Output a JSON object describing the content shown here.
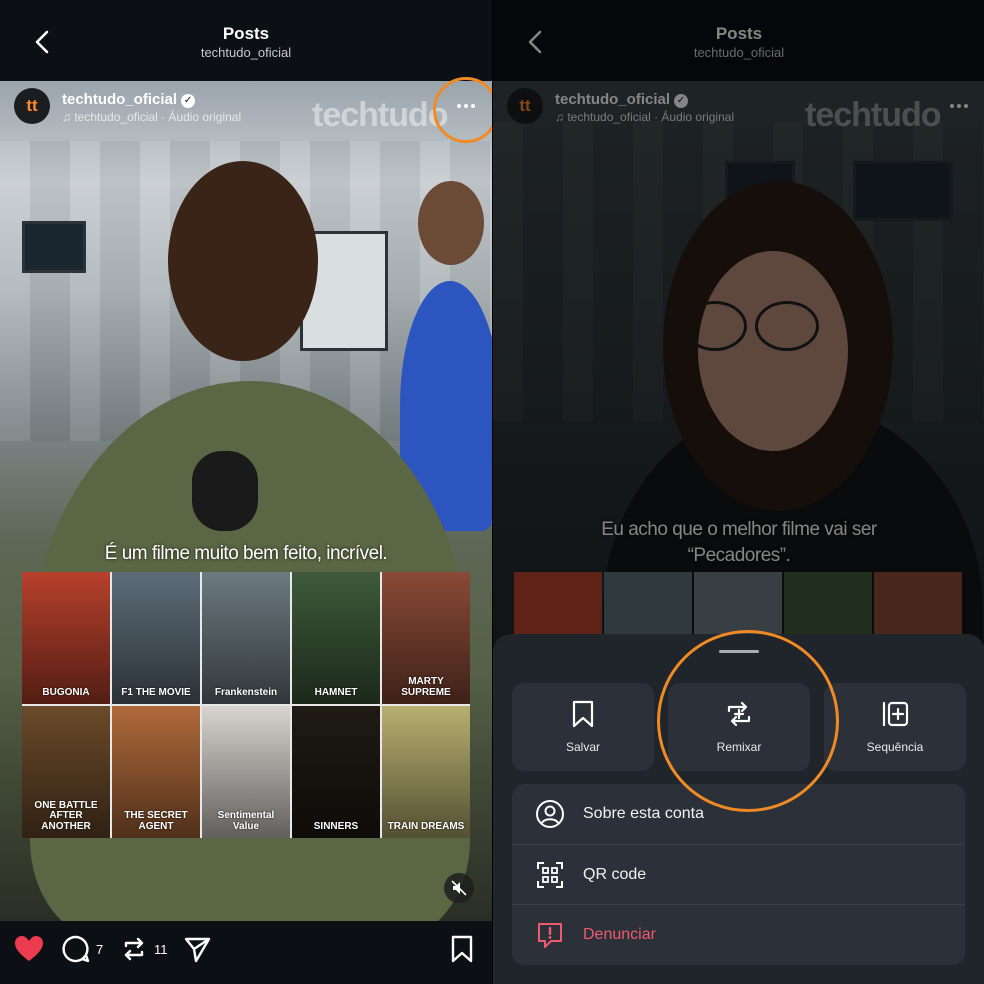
{
  "left": {
    "header": {
      "title": "Posts",
      "subtitle": "techtudo_oficial"
    },
    "account": {
      "avatar": "tt",
      "name": "techtudo_oficial",
      "audio": "techtudo_oficial · Áudio original",
      "watermark": "techtudo"
    },
    "caption": "É um filme muito bem feito, incrível.",
    "posters": [
      {
        "title": "BUGONIA",
        "color": "#b7412c"
      },
      {
        "title": "F1 THE MOVIE",
        "color": "#5d6d78"
      },
      {
        "title": "Frankenstein",
        "color": "#6c7a80"
      },
      {
        "title": "HAMNET",
        "color": "#3e5a3a"
      },
      {
        "title": "MARTY SUPREME",
        "color": "#8a4a36"
      },
      {
        "title": "ONE BATTLE AFTER ANOTHER",
        "color": "#6a4a2a"
      },
      {
        "title": "THE SECRET AGENT",
        "color": "#b06a3a"
      },
      {
        "title": "Sentimental Value",
        "color": "#d8d4cf"
      },
      {
        "title": "SINNERS",
        "color": "#1f1a14"
      },
      {
        "title": "TRAIN DREAMS",
        "color": "#b8b070"
      }
    ],
    "actions": {
      "comments": "7",
      "reposts": "11"
    }
  },
  "right": {
    "header": {
      "title": "Posts",
      "subtitle": "techtudo_oficial"
    },
    "account": {
      "avatar": "tt",
      "name": "techtudo_oficial",
      "audio": "techtudo_oficial · Áudio original",
      "watermark": "techtudo"
    },
    "caption_line1": "Eu acho que o melhor filme vai ser",
    "caption_line2": "“Pecadores”.",
    "sheet": {
      "tiles": [
        {
          "label": "Salvar",
          "icon": "bookmark-icon"
        },
        {
          "label": "Remixar",
          "icon": "remix-icon"
        },
        {
          "label": "Sequência",
          "icon": "sequence-icon"
        }
      ],
      "menu": [
        {
          "label": "Sobre esta conta",
          "icon": "account-icon"
        },
        {
          "label": "QR code",
          "icon": "qr-code-icon"
        },
        {
          "label": "Denunciar",
          "icon": "report-icon"
        }
      ]
    }
  },
  "colors": {
    "highlight": "#f08a24",
    "like": "#ed3b4f",
    "danger": "#ef5a6f",
    "sheet": "#20242b",
    "tile": "#2c3038",
    "brand": "#ff8a2a"
  }
}
